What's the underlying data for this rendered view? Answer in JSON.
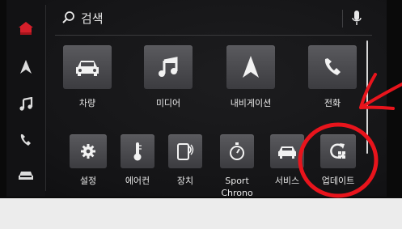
{
  "search": {
    "label": "검색"
  },
  "sidebar": {
    "items": [
      {
        "name": "home",
        "icon": "home-icon",
        "color": "#d51f2a"
      },
      {
        "name": "navigation",
        "icon": "navigation-arrow-icon"
      },
      {
        "name": "media",
        "icon": "music-note-icon"
      },
      {
        "name": "phone",
        "icon": "phone-icon"
      },
      {
        "name": "vehicle",
        "icon": "car-icon"
      }
    ]
  },
  "tiles": {
    "row1": [
      {
        "label": "차량",
        "icon": "car-icon"
      },
      {
        "label": "미디어",
        "icon": "music-note-icon"
      },
      {
        "label": "내비게이션",
        "icon": "navigation-arrow-icon"
      },
      {
        "label": "전화",
        "icon": "phone-icon"
      }
    ],
    "row2": [
      {
        "label": "설정",
        "icon": "gear-icon"
      },
      {
        "label": "에어컨",
        "icon": "thermometer-icon"
      },
      {
        "label": "장치",
        "icon": "device-icon"
      },
      {
        "label": "Sport",
        "sub": "Chrono",
        "icon": "stopwatch-icon"
      },
      {
        "label": "서비스",
        "icon": "service-car-icon"
      },
      {
        "label": "업데이트",
        "icon": "update-icon"
      }
    ]
  },
  "colors": {
    "accent_red": "#d51f2a",
    "annotation_red": "#e8141c",
    "label": "#e8e8e8"
  }
}
